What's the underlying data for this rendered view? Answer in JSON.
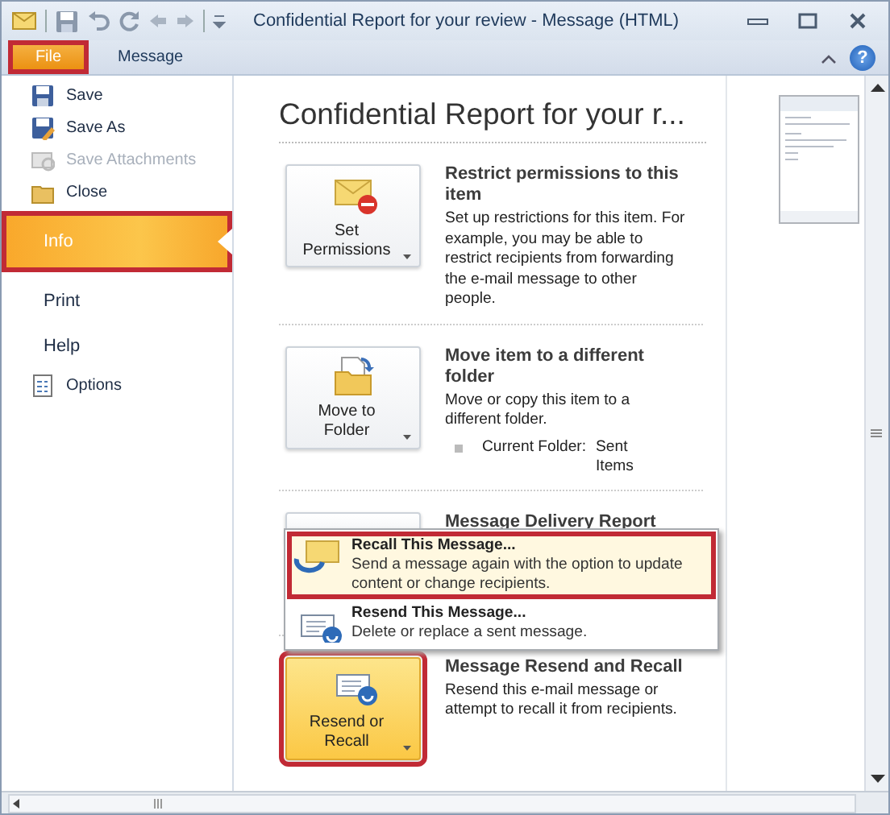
{
  "window": {
    "title": "Confidential Report for your review - Message (HTML)"
  },
  "ribbon": {
    "tabs": [
      {
        "label": "File",
        "selected": true,
        "highlighted": true
      },
      {
        "label": "Message",
        "selected": false,
        "highlighted": false
      }
    ],
    "help_glyph": "?"
  },
  "nav": {
    "items": [
      {
        "label": "Save",
        "kind": "command",
        "disabled": false,
        "highlighted": false
      },
      {
        "label": "Save As",
        "kind": "command",
        "disabled": false,
        "highlighted": false
      },
      {
        "label": "Save Attachments",
        "kind": "command",
        "disabled": true,
        "highlighted": false
      },
      {
        "label": "Close",
        "kind": "command",
        "disabled": false,
        "highlighted": false
      },
      {
        "label": "Info",
        "kind": "tab",
        "selected": true,
        "highlighted": true
      },
      {
        "label": "Print",
        "kind": "tab",
        "selected": false,
        "highlighted": false
      },
      {
        "label": "Help",
        "kind": "tab",
        "selected": false,
        "highlighted": false
      },
      {
        "label": "Options",
        "kind": "command",
        "disabled": false,
        "highlighted": false
      }
    ]
  },
  "info": {
    "heading": "Confidential Report for your r...",
    "sections": [
      {
        "button": {
          "label": "Set Permissions",
          "pressed": false,
          "highlighted": false
        },
        "title": "Restrict permissions to this item",
        "description": "Set up restrictions for this item. For example, you may be able to restrict recipients from forwarding the e-mail message to other people."
      },
      {
        "button": {
          "label": "Move to Folder",
          "pressed": false,
          "highlighted": false
        },
        "title": "Move item to a different folder",
        "description": "Move or copy this item to a different folder.",
        "detail": {
          "label": "Current Folder:",
          "value": "Sent Items"
        }
      },
      {
        "title": "Message Delivery Report"
      },
      {
        "button": {
          "label": "Resend or Recall",
          "pressed": true,
          "highlighted": true
        },
        "title": "Message Resend and Recall",
        "description": "Resend this e-mail message or attempt to recall it from recipients."
      }
    ],
    "menu": {
      "items": [
        {
          "title": "Recall This Message...",
          "description": "Send a message again with the option to update content or change recipients.",
          "highlighted": true
        },
        {
          "title": "Resend This Message...",
          "description": "Delete or replace a sent message.",
          "highlighted": false
        }
      ]
    }
  }
}
